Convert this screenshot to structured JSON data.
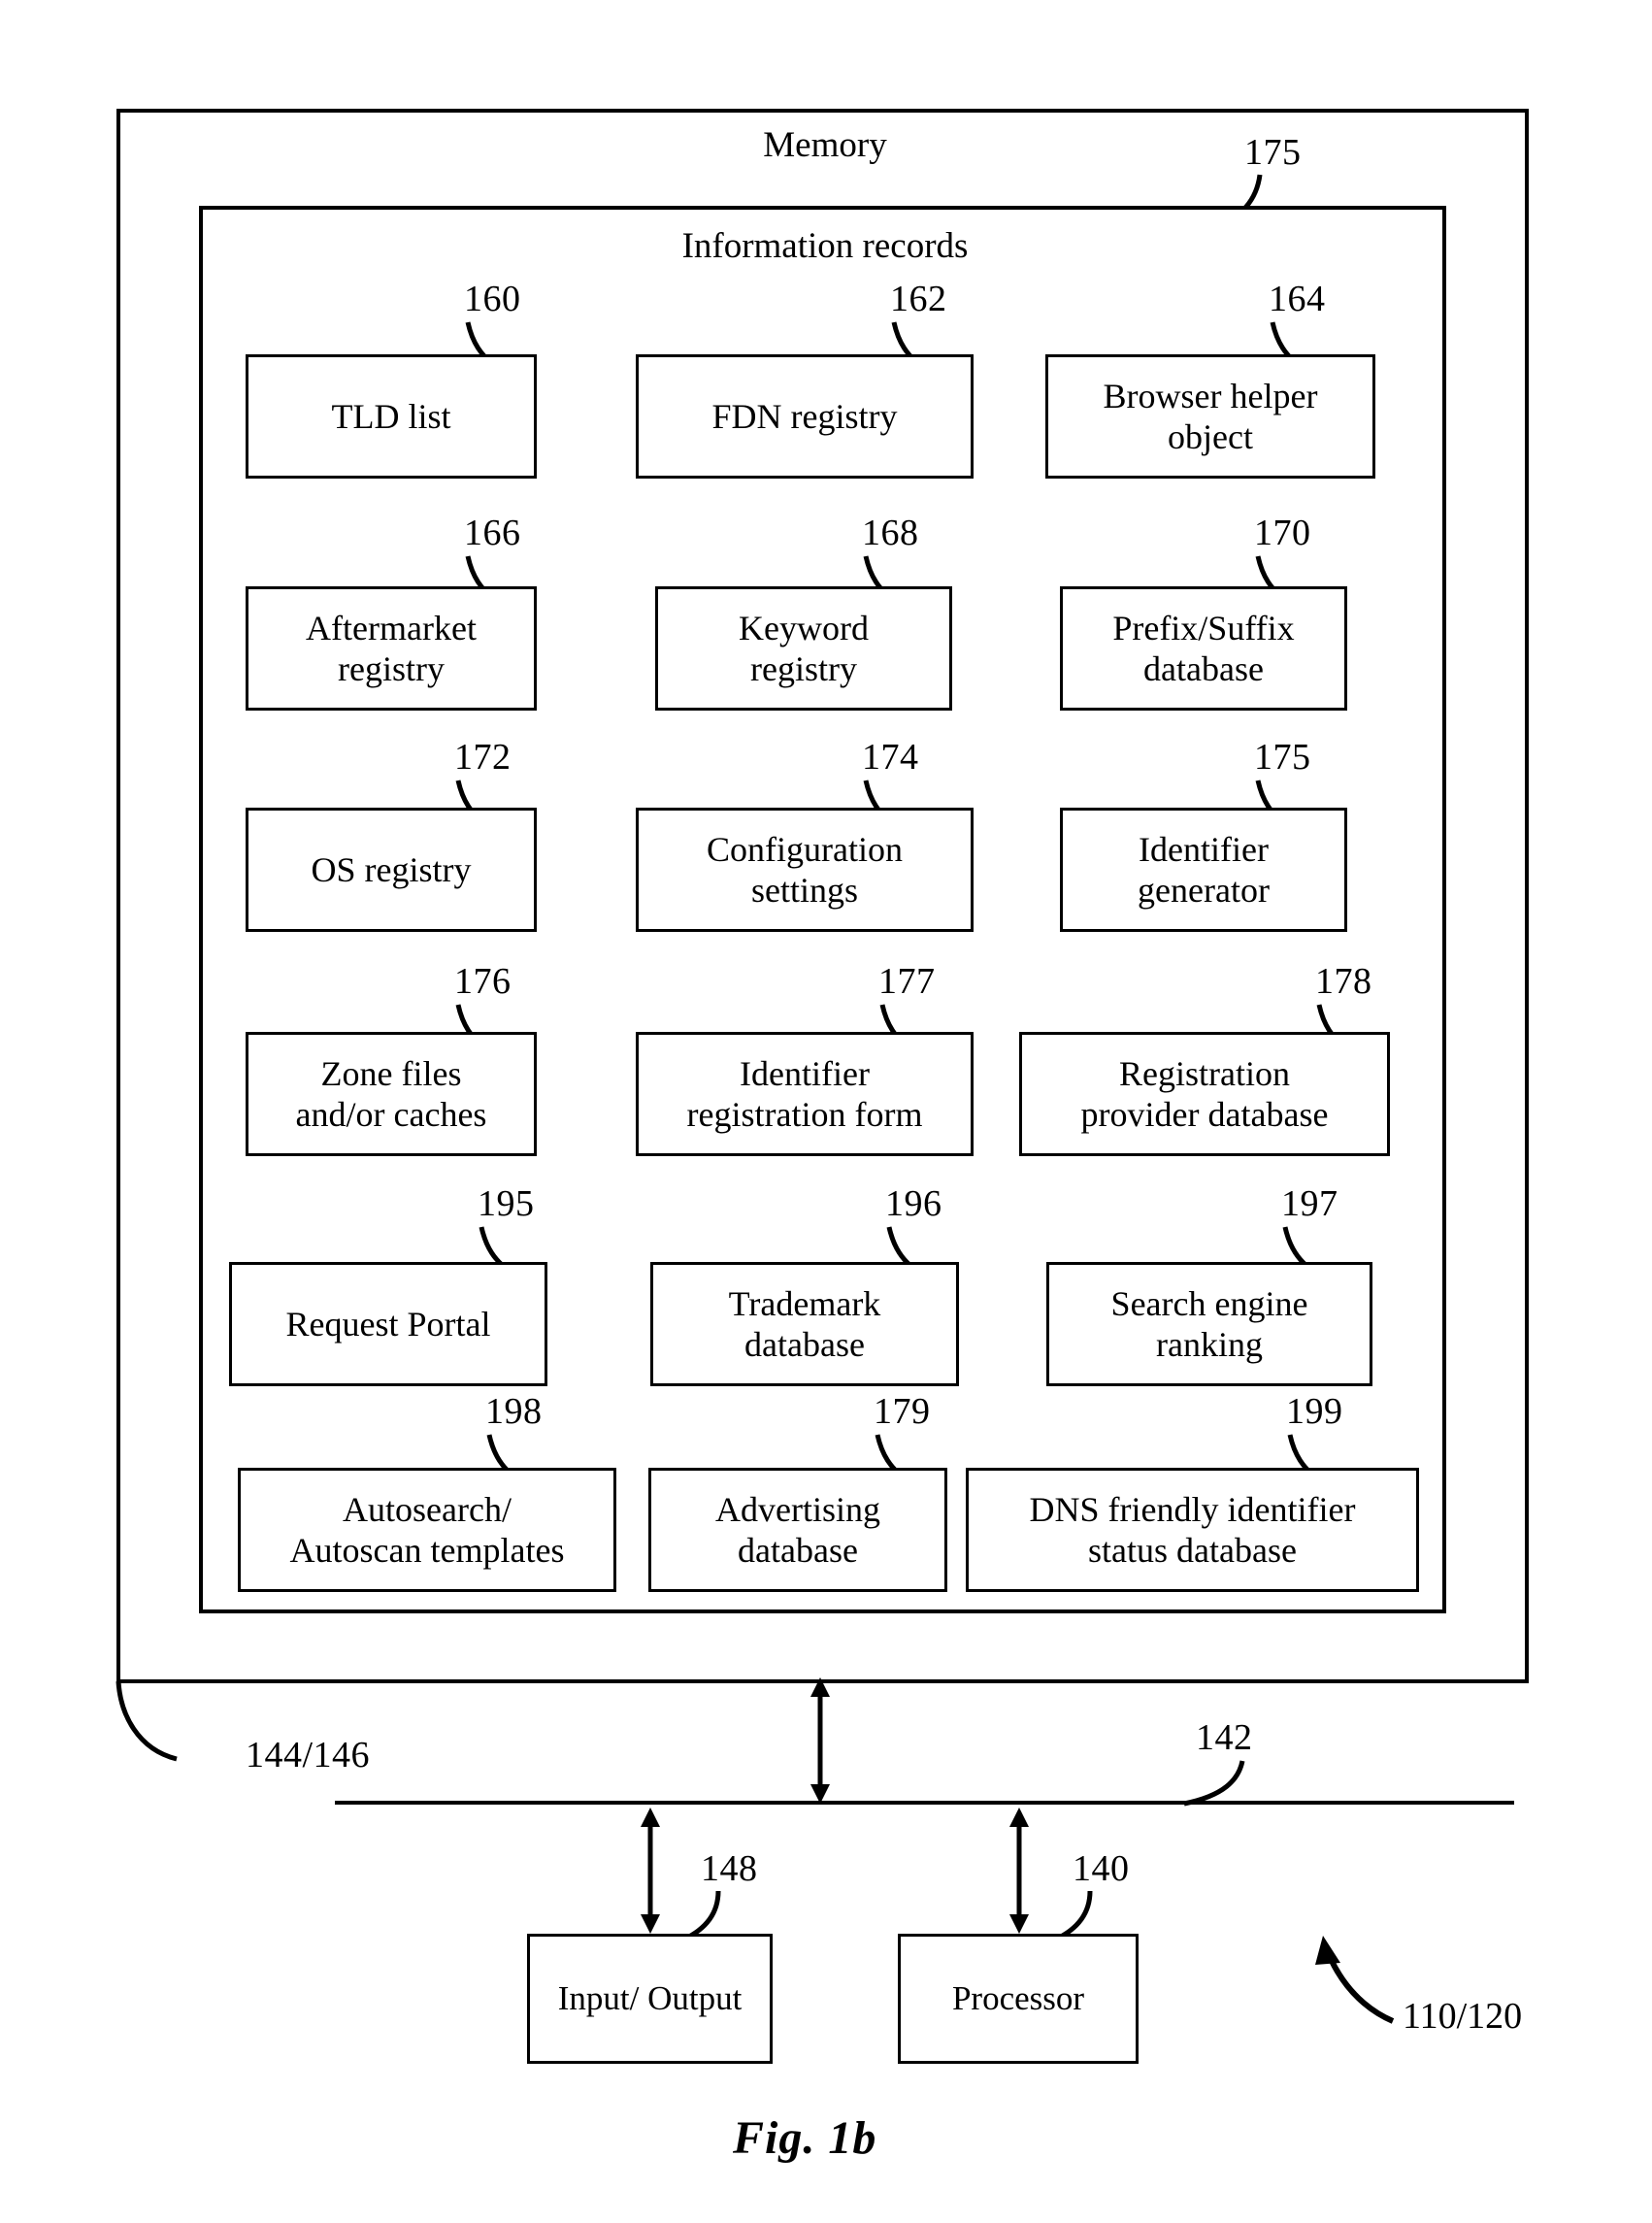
{
  "figure": {
    "caption": "Fig. 1b",
    "memory_title": "Memory",
    "information_records_title": "Information records",
    "memory_ref": "175",
    "memory_bus_ref": "144/146",
    "bus_ref": "142",
    "io_ref": "148",
    "processor_ref": "140",
    "system_ref": "110/120"
  },
  "information_records": {
    "rows": [
      [
        {
          "ref": "160",
          "label": "TLD list",
          "lines": [
            "TLD list"
          ]
        },
        {
          "ref": "162",
          "label": "FDN registry",
          "lines": [
            "FDN registry"
          ]
        },
        {
          "ref": "164",
          "label": "Browser helper object",
          "lines": [
            "Browser helper",
            "object"
          ]
        }
      ],
      [
        {
          "ref": "166",
          "label": "Aftermarket registry",
          "lines": [
            "Aftermarket",
            "registry"
          ]
        },
        {
          "ref": "168",
          "label": "Keyword registry",
          "lines": [
            "Keyword",
            "registry"
          ]
        },
        {
          "ref": "170",
          "label": "Prefix/Suffix database",
          "lines": [
            "Prefix/Suffix",
            "database"
          ]
        }
      ],
      [
        {
          "ref": "172",
          "label": "OS registry",
          "lines": [
            "OS registry"
          ]
        },
        {
          "ref": "174",
          "label": "Configuration settings",
          "lines": [
            "Configuration",
            "settings"
          ]
        },
        {
          "ref": "175",
          "label": "Identifier generator",
          "lines": [
            "Identifier",
            "generator"
          ]
        }
      ],
      [
        {
          "ref": "176",
          "label": "Zone files and/or caches",
          "lines": [
            "Zone files",
            "and/or caches"
          ]
        },
        {
          "ref": "177",
          "label": "Identifier registration form",
          "lines": [
            "Identifier",
            "registration form"
          ]
        },
        {
          "ref": "178",
          "label": "Registration provider database",
          "lines": [
            "Registration",
            "provider database"
          ]
        }
      ],
      [
        {
          "ref": "195",
          "label": "Request Portal",
          "lines": [
            "Request Portal"
          ]
        },
        {
          "ref": "196",
          "label": "Trademark database",
          "lines": [
            "Trademark",
            "database"
          ]
        },
        {
          "ref": "197",
          "label": "Search engine ranking",
          "lines": [
            "Search engine",
            "ranking"
          ]
        }
      ],
      [
        {
          "ref": "198",
          "label": "Autosearch/ Autoscan templates",
          "lines": [
            "Autosearch/",
            "Autoscan templates"
          ]
        },
        {
          "ref": "179",
          "label": "Advertising database",
          "lines": [
            "Advertising",
            "database"
          ]
        },
        {
          "ref": "199",
          "label": "DNS friendly identifier status database",
          "lines": [
            "DNS friendly identifier",
            "status database"
          ]
        }
      ]
    ]
  },
  "components": [
    {
      "ref": "148",
      "label": "Input/ Output",
      "lines": [
        "Input/",
        "Output"
      ]
    },
    {
      "ref": "140",
      "label": "Processor",
      "lines": [
        "Processor"
      ]
    }
  ],
  "colors": {
    "ink": "#000000",
    "paper": "#ffffff"
  }
}
